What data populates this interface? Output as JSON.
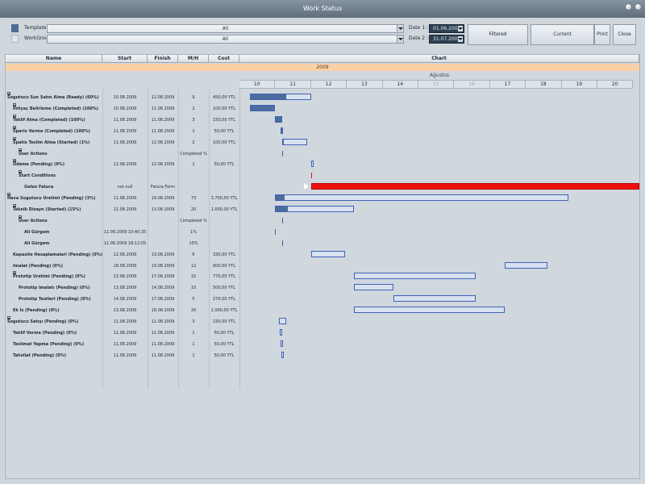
{
  "window": {
    "title": "Work Status"
  },
  "toolbar": {
    "template_label": "Template :",
    "template_value": "All",
    "workgroup_label": "WorkGroup :",
    "workgroup_value": "All",
    "date1_label": "Date 1 :",
    "date1_value": "01.06.2009",
    "date2_label": "Date 2 :",
    "date2_value": "31.07.2009",
    "filtered_label": "Filtered",
    "current_label": "Current",
    "print_label": "Print",
    "close_label": "Close"
  },
  "columns": {
    "name": "Name",
    "start": "Start",
    "finish": "Finish",
    "mh": "M/H",
    "cost": "Cost",
    "chart": "Chart"
  },
  "timeline": {
    "year": "2009",
    "month": "Ağustos",
    "days": [
      "10",
      "11",
      "12",
      "13",
      "14",
      "15",
      "16",
      "17",
      "18",
      "19",
      "20"
    ],
    "weekend_days": [
      "15",
      "16"
    ]
  },
  "rows": [
    {
      "name": "Sogutucu Sun Satın Alma (Ready) (60%)",
      "start": "10.08.2009",
      "finish": "12.08.2009",
      "mh": "9",
      "cost": "450,00 YTL",
      "indent": 0,
      "expander": true
    },
    {
      "name": "İhtiyaç Belirleme (Completed) (100%)",
      "start": "10.08.2009",
      "finish": "11.08.2009",
      "mh": "2",
      "cost": "100,00 YTL",
      "indent": 1,
      "expander": true
    },
    {
      "name": "Teklif Alma (Completed) (100%)",
      "start": "11.08.2009",
      "finish": "11.08.2009",
      "mh": "3",
      "cost": "150,00 YTL",
      "indent": 1,
      "expander": true
    },
    {
      "name": "Sparis Verme (Completed) (100%)",
      "start": "11.08.2009",
      "finish": "11.08.2009",
      "mh": "1",
      "cost": "50,00 YTL",
      "indent": 1,
      "expander": true
    },
    {
      "name": "Spatis Teslim Alma (Started) (1%)",
      "start": "11.08.2009",
      "finish": "12.08.2009",
      "mh": "2",
      "cost": "100,00 YTL",
      "indent": 1,
      "expander": true
    },
    {
      "name": "User Actions",
      "start": "",
      "finish": "",
      "mh": "Completed %",
      "cost": "",
      "indent": 2,
      "expander": true
    },
    {
      "name": "Odeme (Pending) (0%)",
      "start": "12.08.2009",
      "finish": "12.08.2009",
      "mh": "1",
      "cost": "50,00 YTL",
      "indent": 1,
      "expander": true
    },
    {
      "name": "Start Conditions",
      "start": "",
      "finish": "",
      "mh": "",
      "cost": "",
      "indent": 2,
      "expander": true
    },
    {
      "name": "Gelen Fatura",
      "start": "not null",
      "finish": "Fatura Form",
      "mh": "",
      "cost": "",
      "indent": 3,
      "expander": false
    },
    {
      "name": "Hava Sogutucu Uretimi (Pending) (3%)",
      "start": "11.08.2009",
      "finish": "19.08.2009",
      "mh": "73",
      "cost": "3.700,00 YTL",
      "indent": 0,
      "expander": true
    },
    {
      "name": "Teknik Dizayn (Started) (15%)",
      "start": "11.08.2009",
      "finish": "13.08.2009",
      "mh": "20",
      "cost": "1.000,00 YTL",
      "indent": 1,
      "expander": true
    },
    {
      "name": "User Actions",
      "start": "",
      "finish": "",
      "mh": "Completed %",
      "cost": "",
      "indent": 2,
      "expander": true
    },
    {
      "name": "Ali Gürgem",
      "start": "11.08.2009 10:40:35",
      "finish": "",
      "mh": "1%",
      "cost": "",
      "indent": 3,
      "expander": false
    },
    {
      "name": "Ali Gürgem",
      "start": "11.08.2009 18:12:05",
      "finish": "",
      "mh": "15%",
      "cost": "",
      "indent": 3,
      "expander": false
    },
    {
      "name": "Kapasite Hesaplamalari (Pending) (0%)",
      "start": "12.08.2009",
      "finish": "13.08.2009",
      "mh": "6",
      "cost": "330,00 YTL",
      "indent": 1,
      "expander": false
    },
    {
      "name": "Imalat (Pending) (0%)",
      "start": "18.08.2009",
      "finish": "19.08.2009",
      "mh": "12",
      "cost": "600,00 YTL",
      "indent": 1,
      "expander": false
    },
    {
      "name": "Prototip Uretimi (Pending) (0%)",
      "start": "13.08.2009",
      "finish": "17.08.2009",
      "mh": "15",
      "cost": "770,00 YTL",
      "indent": 1,
      "expander": true
    },
    {
      "name": "Prototip Imalatı (Pending) (0%)",
      "start": "13.08.2009",
      "finish": "14.08.2009",
      "mh": "10",
      "cost": "500,00 YTL",
      "indent": 2,
      "expander": false
    },
    {
      "name": "Prototip Testleri (Pending) (0%)",
      "start": "14.08.2009",
      "finish": "17.08.2009",
      "mh": "5",
      "cost": "270,00 YTL",
      "indent": 2,
      "expander": false
    },
    {
      "name": "Ek Is (Pending) (0%)",
      "start": "13.08.2009",
      "finish": "18.08.2009",
      "mh": "20",
      "cost": "1.000,00 YTL",
      "indent": 1,
      "expander": false
    },
    {
      "name": "Sogutucu Satışı (Pending) (0%)",
      "start": "11.08.2009",
      "finish": "11.08.2009",
      "mh": "3",
      "cost": "150,00 YTL",
      "indent": 0,
      "expander": true
    },
    {
      "name": "Teklif Verme (Pending) (0%)",
      "start": "11.08.2009",
      "finish": "11.08.2009",
      "mh": "1",
      "cost": "50,00 YTL",
      "indent": 1,
      "expander": false
    },
    {
      "name": "Teslimat Yapma (Pending) (0%)",
      "start": "11.08.2009",
      "finish": "11.08.2009",
      "mh": "1",
      "cost": "50,00 YTL",
      "indent": 1,
      "expander": false
    },
    {
      "name": "Tahsilat (Pending) (0%)",
      "start": "11.08.2009",
      "finish": "11.08.2009",
      "mh": "1",
      "cost": "50,00 YTL",
      "indent": 1,
      "expander": false
    }
  ],
  "colors": {
    "bar_border": "#3f64b5",
    "bar_fill": "#4b6c9c",
    "critical": "#ee1010",
    "year_band": "#fbd0a6"
  }
}
